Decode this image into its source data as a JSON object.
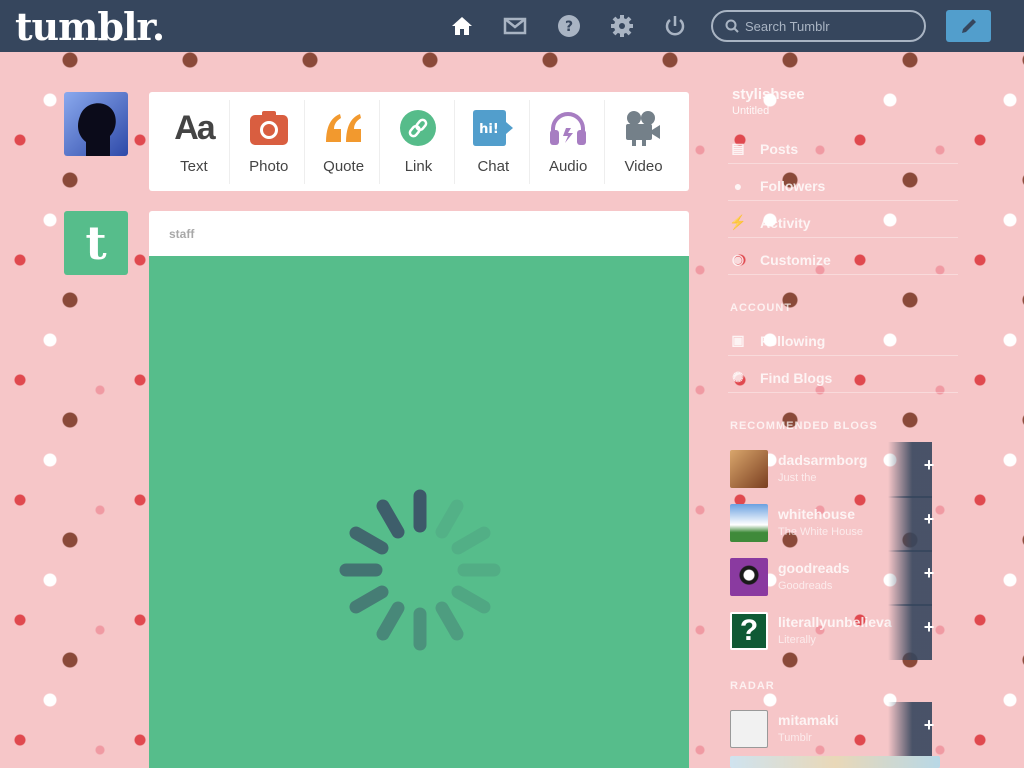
{
  "header": {
    "logo": "tumblr.",
    "nav_icons": [
      "home-icon",
      "inbox-icon",
      "help-icon",
      "settings-icon",
      "logout-icon"
    ],
    "search_placeholder": "Search Tumblr",
    "compose_icon": "pencil-icon",
    "colors": {
      "bar": "#36465d",
      "compose": "#529ecc",
      "icon": "#a9b4c3"
    }
  },
  "left": {
    "staff_avatar_letter": "t"
  },
  "post_types": [
    {
      "label": "Text",
      "icon": "text-icon",
      "glyph": "Aa",
      "color": "#444444"
    },
    {
      "label": "Photo",
      "icon": "camera-icon",
      "color": "#d95e40"
    },
    {
      "label": "Quote",
      "icon": "quote-icon",
      "glyph": "66",
      "color": "#f2992e"
    },
    {
      "label": "Link",
      "icon": "link-icon",
      "color": "#56bc8a"
    },
    {
      "label": "Chat",
      "icon": "chat-icon",
      "glyph": "hi!",
      "color": "#529ecc"
    },
    {
      "label": "Audio",
      "icon": "headphones-icon",
      "color": "#a77dc2"
    },
    {
      "label": "Video",
      "icon": "video-camera-icon",
      "color": "#748089"
    }
  ],
  "post": {
    "author": "staff",
    "body_color": "#56bd8b"
  },
  "sidebar": {
    "blog_name": "stylishsee",
    "blog_sub": "Untitled",
    "items": [
      {
        "label": "Posts",
        "icon": "posts-icon"
      },
      {
        "label": "Followers",
        "icon": "followers-icon"
      },
      {
        "label": "Activity",
        "icon": "activity-icon"
      },
      {
        "label": "Customize",
        "icon": "eye-icon"
      }
    ],
    "account_heading": "ACCOUNT",
    "account_items": [
      {
        "label": "Following",
        "icon": "following-icon"
      },
      {
        "label": "Find Blogs",
        "icon": "find-blogs-icon"
      }
    ],
    "recommended_heading": "RECOMMENDED BLOGS",
    "recommended": [
      {
        "name": "dadsarmborg",
        "sub": "Just the",
        "thumb": "#b5764a"
      },
      {
        "name": "whitehouse",
        "sub": "The White House",
        "thumb": "#5c8fcf"
      },
      {
        "name": "goodreads",
        "sub": "Goodreads",
        "thumb": "#7c4a8e"
      },
      {
        "name": "literallyunbelieva",
        "sub": "Literally",
        "thumb": "#1f6b3f"
      }
    ],
    "radar_heading": "RADAR",
    "radar": [
      {
        "name": "mitamaki",
        "sub": "Tumblr",
        "thumb": "#d8d8d8"
      }
    ]
  }
}
